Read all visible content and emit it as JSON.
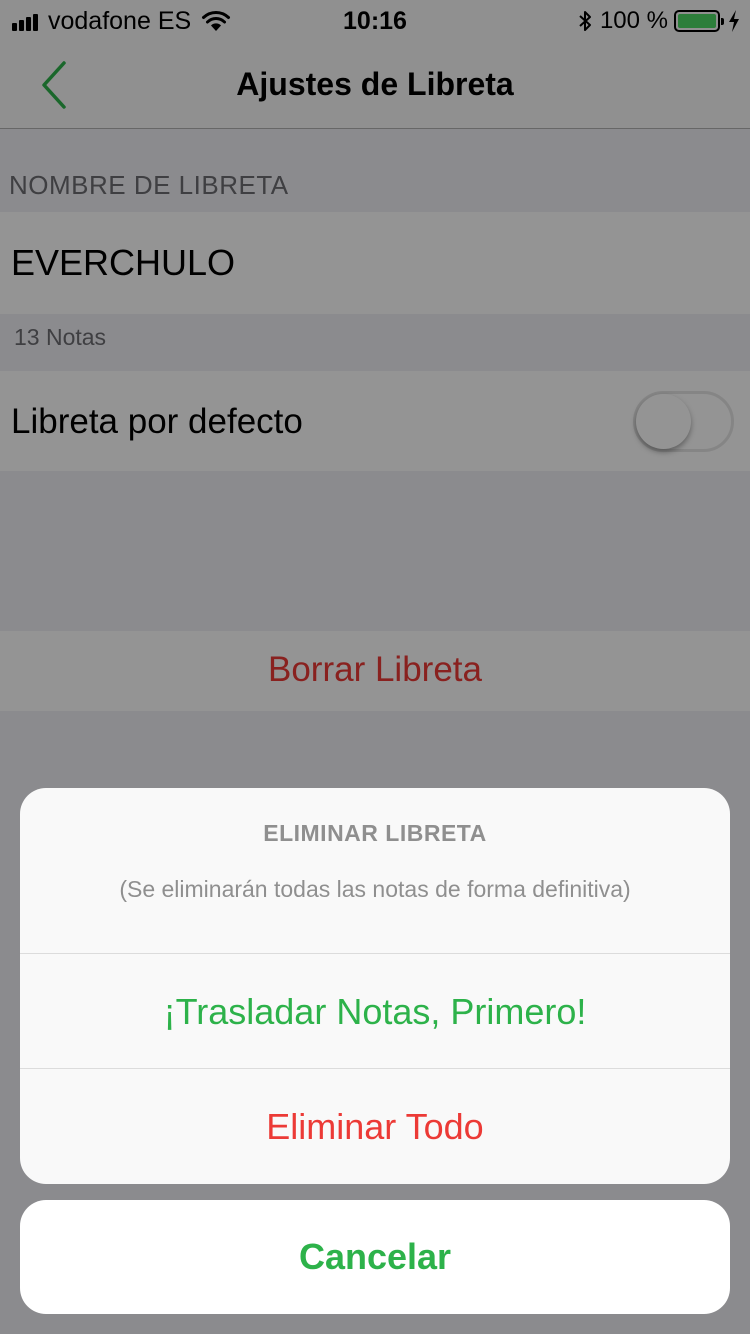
{
  "status_bar": {
    "carrier": "vodafone ES",
    "time": "10:16",
    "battery_percent": "100 %",
    "battery_level": 1.0,
    "icons": [
      "signal-icon",
      "wifi-icon",
      "bluetooth-icon",
      "battery-icon",
      "charging-bolt-icon"
    ]
  },
  "nav": {
    "title": "Ajustes de Libreta",
    "back_icon": "chevron-left-icon"
  },
  "settings": {
    "section_header": "NOMBRE DE LIBRETA",
    "notebook_name": "EVERCHULO",
    "note_count": "13 Notas",
    "default_label": "Libreta por defecto",
    "default_enabled": false,
    "delete_label": "Borrar Libreta"
  },
  "action_sheet": {
    "title": "ELIMINAR LIBRETA",
    "message": "(Se eliminarán todas las notas de forma definitiva)",
    "move_label": "¡Trasladar Notas, Primero!",
    "delete_all_label": "Eliminar Todo",
    "cancel_label": "Cancelar"
  },
  "colors": {
    "accent_green": "#2db24a",
    "destructive_red": "#ec3a36",
    "dimmed_red": "#8a1d1b",
    "battery_green": "#4cd964"
  }
}
